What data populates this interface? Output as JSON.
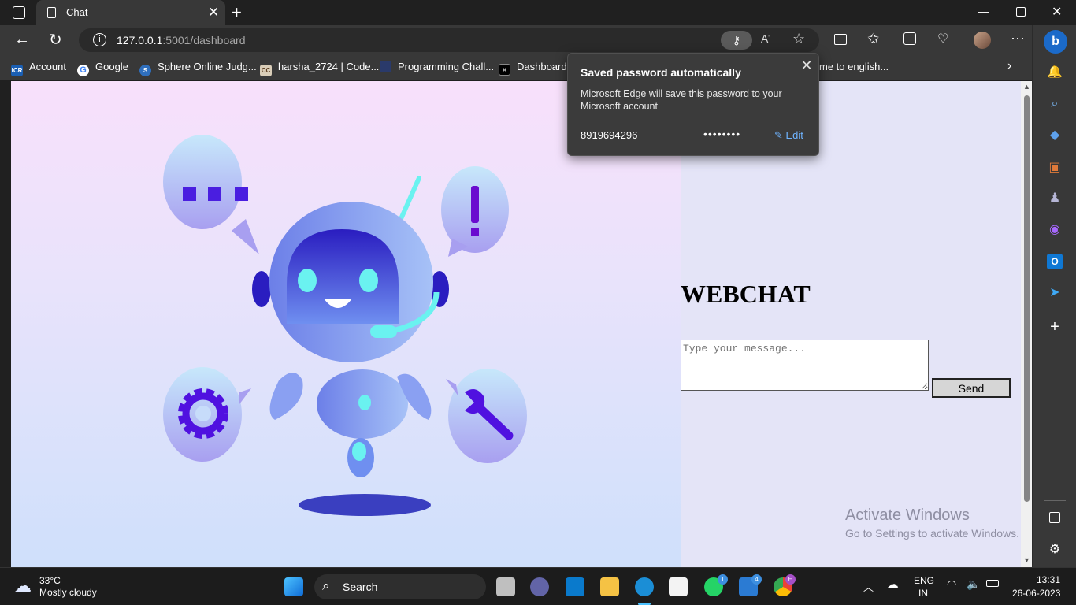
{
  "browser": {
    "tab_title": "Chat",
    "url_host": "127.0.0.1",
    "url_rest": ":5001/dashboard"
  },
  "bookmarks": [
    {
      "label": "Account",
      "icon": "icr-icon",
      "color": "#1a5fb4"
    },
    {
      "label": "Google",
      "icon": "google-icon",
      "color": "#ffffff"
    },
    {
      "label": "Sphere Online Judg...",
      "icon": "spoj-icon",
      "color": "#2f6fbd"
    },
    {
      "label": "harsha_2724 | Code...",
      "icon": "codechef-icon",
      "color": "#d9cdb8"
    },
    {
      "label": "Programming Chall...",
      "icon": "challenge-icon",
      "color": "#2a3a6a"
    },
    {
      "label": "Dashboard |",
      "icon": "hackerrank-icon",
      "color": "#000000"
    },
    {
      "label": "me to english...",
      "icon": "translate-icon",
      "color": "#444444"
    }
  ],
  "popup": {
    "title": "Saved password automatically",
    "description": "Microsoft Edge will save this password to your Microsoft account",
    "username": "8919694296",
    "password_mask": "••••••••",
    "edit_label": "Edit"
  },
  "page": {
    "heading": "WEBCHAT",
    "message_placeholder": "Type your message...",
    "send_label": "Send",
    "activate_title": "Activate Windows",
    "activate_sub": "Go to Settings to activate Windows."
  },
  "taskbar": {
    "weather_temp": "33°C",
    "weather_desc": "Mostly cloudy",
    "search_label": "Search",
    "lang_top": "ENG",
    "lang_bottom": "IN",
    "time": "13:31",
    "date": "26-06-2023",
    "whatsapp_badge": "1",
    "app_badge": "4",
    "chrome_badge": "H"
  },
  "colors": {
    "accent_edit": "#6fb4ff",
    "page_bg": "#e4e4f7",
    "robot_primary": "#6f8ff0"
  }
}
